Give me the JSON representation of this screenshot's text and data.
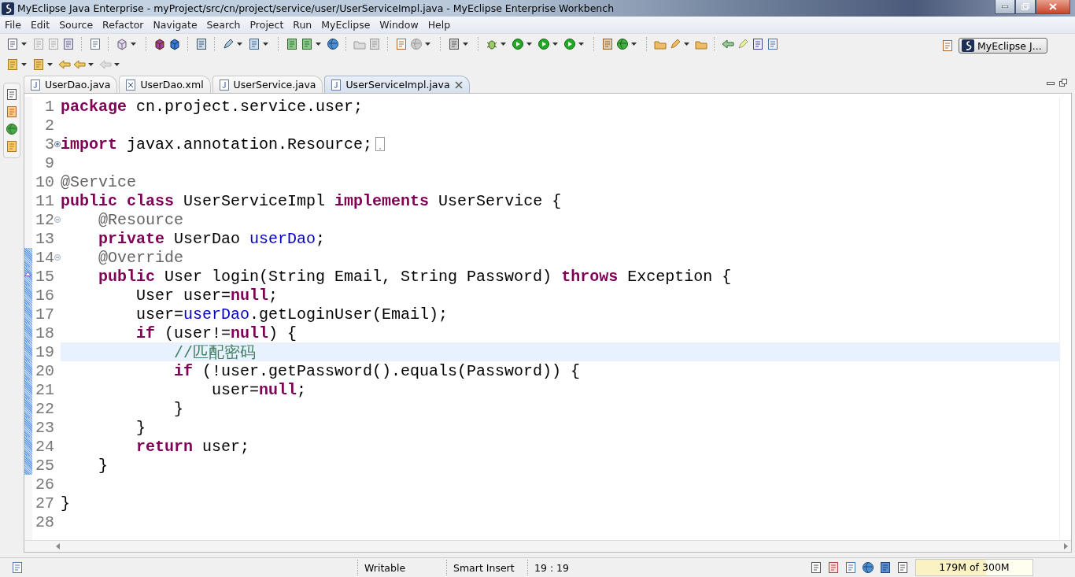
{
  "window": {
    "title": "MyEclipse Java Enterprise - myProject/src/cn/project/service/user/UserServiceImpl.java - MyEclipse Enterprise Workbench"
  },
  "menu": [
    "File",
    "Edit",
    "Source",
    "Refactor",
    "Navigate",
    "Search",
    "Project",
    "Run",
    "MyEclipse",
    "Window",
    "Help"
  ],
  "perspective": {
    "label": "MyEclipse J...",
    "selected": true
  },
  "tabs": [
    {
      "label": "UserDao.java",
      "kind": "java",
      "selected": false
    },
    {
      "label": "UserDao.xml",
      "kind": "xml",
      "selected": false
    },
    {
      "label": "UserService.java",
      "kind": "java",
      "selected": false
    },
    {
      "label": "UserServiceImpl.java",
      "kind": "java",
      "selected": true
    }
  ],
  "editor": {
    "lines": [
      {
        "number": "1",
        "range": false,
        "current": false,
        "tokens": [
          {
            "kind": "keyword",
            "text": "package"
          },
          {
            "kind": "plain",
            "text": " cn.project.service.user;"
          }
        ]
      },
      {
        "number": "2",
        "range": false,
        "current": false
      },
      {
        "number": "3",
        "expanded": false,
        "range": false,
        "current": false,
        "tokens": [
          {
            "kind": "keyword",
            "text": "import"
          },
          {
            "kind": "plain",
            "text": " javax.annotation.Resource;"
          }
        ]
      },
      {
        "number": "9",
        "range": false,
        "current": false
      },
      {
        "number": "10",
        "range": false,
        "current": false,
        "tokens": [
          {
            "kind": "annotation",
            "text": "@Service"
          }
        ]
      },
      {
        "number": "11",
        "range": false,
        "current": false,
        "tokens": [
          {
            "kind": "keyword",
            "text": "public class"
          },
          {
            "kind": "plain",
            "text": " UserServiceImpl "
          },
          {
            "kind": "keyword",
            "text": "implements"
          },
          {
            "kind": "plain",
            "text": " UserService {"
          }
        ]
      },
      {
        "number": "12",
        "expanded": true,
        "range": false,
        "current": false,
        "tokens": [
          {
            "kind": "annotation",
            "text": "    @Resource"
          }
        ]
      },
      {
        "number": "13",
        "range": false,
        "current": false,
        "tokens": [
          {
            "kind": "keyword",
            "text": "    private"
          },
          {
            "kind": "plain",
            "text": " UserDao "
          },
          {
            "kind": "field",
            "text": "userDao"
          },
          {
            "kind": "plain",
            "text": ";"
          }
        ]
      },
      {
        "number": "14",
        "expanded": true,
        "range": true,
        "current": false,
        "tokens": [
          {
            "kind": "annotation",
            "text": "    @Override"
          }
        ]
      },
      {
        "number": "15",
        "range": true,
        "override": true,
        "current": false,
        "tokens": [
          {
            "kind": "keyword",
            "text": "    public"
          },
          {
            "kind": "plain",
            "text": " User login(String Email, String Password) "
          },
          {
            "kind": "keyword",
            "text": "throws"
          },
          {
            "kind": "plain",
            "text": " Exception {"
          }
        ]
      },
      {
        "number": "16",
        "range": true,
        "current": false,
        "tokens": [
          {
            "kind": "plain",
            "text": "        User user="
          },
          {
            "kind": "keyword",
            "text": "null"
          },
          {
            "kind": "plain",
            "text": ";"
          }
        ]
      },
      {
        "number": "17",
        "range": true,
        "current": false,
        "tokens": [
          {
            "kind": "plain",
            "text": "        user="
          },
          {
            "kind": "field",
            "text": "userDao"
          },
          {
            "kind": "plain",
            "text": ".getLoginUser(Email);"
          }
        ]
      },
      {
        "number": "18",
        "range": true,
        "current": false,
        "tokens": [
          {
            "kind": "keyword",
            "text": "        if"
          },
          {
            "kind": "plain",
            "text": " (user!="
          },
          {
            "kind": "keyword",
            "text": "null"
          },
          {
            "kind": "plain",
            "text": ") {"
          }
        ]
      },
      {
        "number": "19",
        "range": true,
        "current": true,
        "tokens": [
          {
            "kind": "comment",
            "text": "            //匹配密码"
          }
        ]
      },
      {
        "number": "20",
        "range": true,
        "current": false,
        "tokens": [
          {
            "kind": "keyword",
            "text": "            if"
          },
          {
            "kind": "plain",
            "text": " (!user.getPassword().equals(Password)) {"
          }
        ]
      },
      {
        "number": "21",
        "range": true,
        "current": false,
        "tokens": [
          {
            "kind": "plain",
            "text": "                user="
          },
          {
            "kind": "keyword",
            "text": "null"
          },
          {
            "kind": "plain",
            "text": ";"
          }
        ]
      },
      {
        "number": "22",
        "range": true,
        "current": false,
        "tokens": [
          {
            "kind": "plain",
            "text": "            }"
          }
        ]
      },
      {
        "number": "23",
        "range": true,
        "current": false,
        "tokens": [
          {
            "kind": "plain",
            "text": "        }"
          }
        ]
      },
      {
        "number": "24",
        "range": true,
        "current": false,
        "tokens": [
          {
            "kind": "keyword",
            "text": "        return"
          },
          {
            "kind": "plain",
            "text": " user;"
          }
        ]
      },
      {
        "number": "25",
        "range": true,
        "current": false,
        "tokens": [
          {
            "kind": "plain",
            "text": "    }"
          }
        ]
      },
      {
        "number": "26",
        "range": false,
        "current": false
      },
      {
        "number": "27",
        "range": false,
        "current": false,
        "tokens": [
          {
            "kind": "plain",
            "text": "}"
          }
        ]
      },
      {
        "number": "28",
        "range": false,
        "current": false
      }
    ]
  },
  "status_bar": {
    "mode": "Writable",
    "insert": "Smart Insert",
    "position": "19 : 19",
    "memory": {
      "text": "179M of 300M",
      "level": 0.6
    }
  }
}
